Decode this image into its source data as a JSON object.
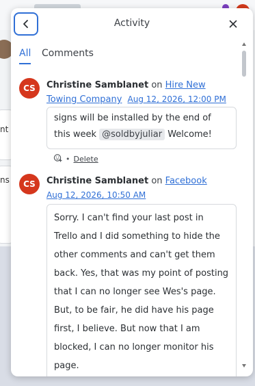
{
  "background": {
    "fragment_1": "nt",
    "fragment_2": "ns"
  },
  "popover": {
    "title": "Activity",
    "back_icon": "chevron-left-icon",
    "close_icon": "close-icon",
    "accent_color": "#2f6fd6",
    "tabs": [
      {
        "label": "All",
        "active": true
      },
      {
        "label": "Comments",
        "active": false
      }
    ]
  },
  "entries": [
    {
      "initials": "CS",
      "avatar_color": "#d5371d",
      "author": "Christine Samblanet",
      "on_word": "on",
      "target": "Hire New Towing Company",
      "timestamp": "Aug 12, 2026, 12:00 PM",
      "comment_before": "signs will be installed by the end of this week",
      "mention": "@soldbyjuliar",
      "comment_after": "Welcome!",
      "reaction_icon": "add-reaction-icon",
      "separator": "•",
      "delete_label": "Delete"
    },
    {
      "initials": "CS",
      "avatar_color": "#d5371d",
      "author": "Christine Samblanet",
      "on_word": "on",
      "target": "Facebook",
      "timestamp": "Aug 12, 2026, 10:50 AM",
      "comment": "Sorry. I can't find your last post in Trello and I did something to hide the other comments and can't get them back. Yes, that was my point of posting that I can no longer see Wes's page. But, to be fair, he did have his page first, I believe. But now that I am blocked, I can no longer monitor his page."
    }
  ]
}
